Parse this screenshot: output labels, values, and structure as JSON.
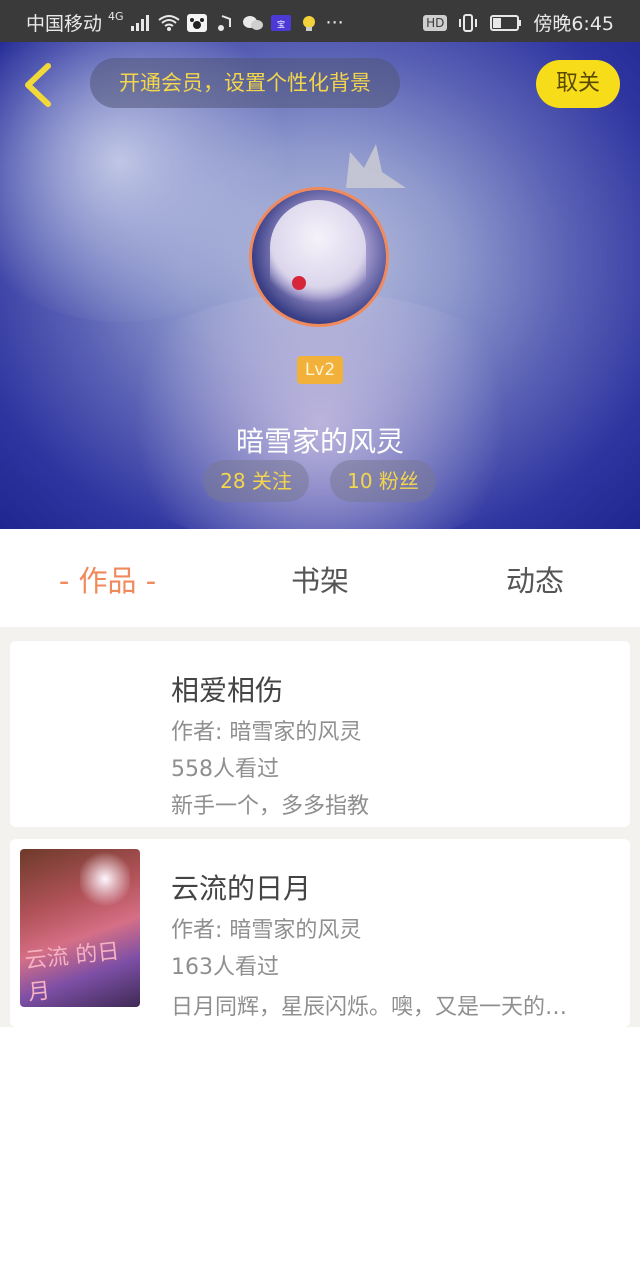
{
  "status_bar": {
    "carrier": "中国移动",
    "network": "4G",
    "time": "傍晚6:45",
    "hd_label": "HD",
    "more": "···"
  },
  "header": {
    "vip_banner": "开通会员，设置个性化背景",
    "follow_button": "取关",
    "back_icon": "chevron-left-icon"
  },
  "profile": {
    "level": "Lv2",
    "username": "暗雪家的风灵",
    "following": "28 关注",
    "fans": "10 粉丝"
  },
  "tabs": [
    {
      "label": "- 作品 -",
      "active": true
    },
    {
      "label": "书架",
      "active": false
    },
    {
      "label": "动态",
      "active": false
    }
  ],
  "works": [
    {
      "title": "相爱相伤",
      "author": "作者: 暗雪家的风灵",
      "views": "558人看过",
      "description": "新手一个，多多指教",
      "has_cover": false
    },
    {
      "title": "云流的日月",
      "author": "作者: 暗雪家的风灵",
      "views": "163人看过",
      "description": "日月同辉，星辰闪烁。噢，又是一天的…",
      "has_cover": true,
      "cover_text": "云流 的日月"
    }
  ],
  "colors": {
    "accent": "#f08a5d",
    "gold": "#f3d64c",
    "follow_bg": "#f7dc1a",
    "level_bg": "#f2b13b"
  }
}
